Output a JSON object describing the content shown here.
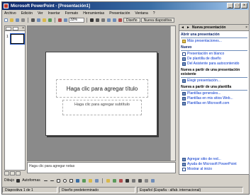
{
  "window": {
    "title": "Microsoft PowerPoint - [Presentación1]"
  },
  "menubar": {
    "items": [
      "Archivo",
      "Edición",
      "Ver",
      "Insertar",
      "Formato",
      "Herramientas",
      "Presentación",
      "Ventana",
      "?"
    ]
  },
  "toolbar": {
    "zoom": "33%",
    "design_label": "Diseño",
    "new_slide_label": "Nueva diapositiva"
  },
  "slide": {
    "title_placeholder": "Haga clic para agregar título",
    "subtitle_placeholder": "Haga clic para agregar subtítulo"
  },
  "outline": {
    "slide_number": "1"
  },
  "notes": {
    "placeholder": "Haga clic para agregar notas"
  },
  "task_pane": {
    "header_title": "Nueva presentación",
    "sections": [
      {
        "title": "Abrir una presentación",
        "items": [
          {
            "label": "Más presentaciones...",
            "icon": "folder-icon"
          }
        ]
      },
      {
        "title": "Nuevo",
        "items": [
          {
            "label": "Presentación en blanco",
            "icon": "blank-presentation-icon"
          },
          {
            "label": "De plantilla de diseño",
            "icon": "design-template-icon"
          },
          {
            "label": "Del Asistente para autocontenido",
            "icon": "wizard-icon"
          }
        ]
      },
      {
        "title": "Nueva a partir de una presentación existente",
        "items": [
          {
            "label": "Elegir presentación...",
            "icon": "presentation-icon"
          }
        ]
      },
      {
        "title": "Nueva a partir de una plantilla",
        "items": [
          {
            "label": "Plantillas generales...",
            "icon": "templates-icon"
          },
          {
            "label": "Plantillas en mis sitios Web...",
            "icon": "web-templates-icon"
          },
          {
            "label": "Plantillas en Microsoft.com",
            "icon": "online-templates-icon"
          }
        ]
      }
    ],
    "footer": [
      {
        "label": "Agregar sitio de red...",
        "icon": "network-place-icon"
      },
      {
        "label": "Ayuda de Microsoft PowerPoint",
        "icon": "help-icon"
      },
      {
        "label": "Mostrar al inicio",
        "icon": "checkbox-icon"
      }
    ]
  },
  "draw_toolbar": {
    "draw_label": "Dibujo",
    "autoshapes_label": "Autoformas"
  },
  "statusbar": {
    "slide_info": "Diapositiva 1 de 1",
    "design_name": "Diseño predeterminado",
    "language": "Español (España - alfab. internacional)"
  }
}
